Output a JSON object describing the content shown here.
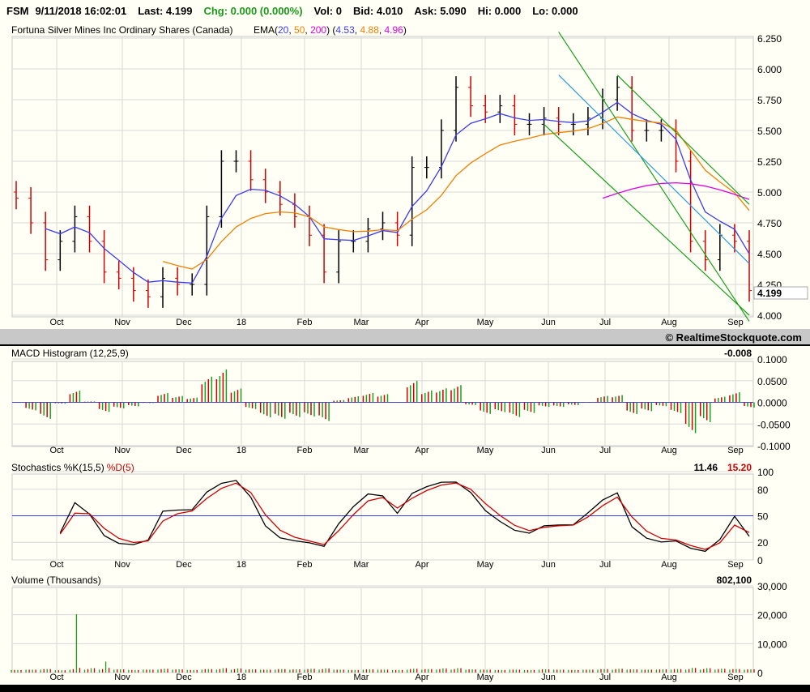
{
  "quote": {
    "symbol": "FSM",
    "datetime": "9/11/2018 16:02:01",
    "last": "Last: 4.199",
    "chg": "Chg: 0.000 (0.000%)",
    "vol": "Vol: 0",
    "bid": "Bid: 4.010",
    "ask": "Ask: 5.090",
    "hi": "Hi: 0.000",
    "lo": "Lo: 0.000"
  },
  "copyright": "© RealtimeStockquote.com",
  "chart_data": [
    {
      "type": "ohlc",
      "title": "Fortuna Silver Mines Inc Ordinary Shares (Canada)",
      "ema_label": "EMA(",
      "ema_periods": [
        "20",
        "50",
        "200"
      ],
      "ema_values": [
        "4.53",
        "4.88",
        "4.96"
      ],
      "ema_colors": [
        "#3b3bf0",
        "#f08000",
        "#e000e0"
      ],
      "last_label": "4.199",
      "x_ticks": [
        "Oct",
        "Nov",
        "Dec",
        "18",
        "Feb",
        "Mar",
        "Apr",
        "May",
        "Jun",
        "Jul",
        "Aug",
        "Sep"
      ],
      "y_ticks": [
        "6.250",
        "6.000",
        "5.750",
        "5.500",
        "5.250",
        "5.000",
        "4.750",
        "4.500",
        "4.250",
        "4.000"
      ],
      "ylim": [
        4.0,
        6.25
      ],
      "weekly_close": [
        4.95,
        4.75,
        4.45,
        4.6,
        4.8,
        4.6,
        4.35,
        4.3,
        4.2,
        4.15,
        4.3,
        4.25,
        4.25,
        4.8,
        5.25,
        5.25,
        5.1,
        5.0,
        4.9,
        4.8,
        4.65,
        4.35,
        4.6,
        4.6,
        4.7,
        4.75,
        4.65,
        5.2,
        5.2,
        5.5,
        5.85,
        5.7,
        5.65,
        5.7,
        5.55,
        5.55,
        5.6,
        5.55,
        5.55,
        5.6,
        5.75,
        5.85,
        5.5,
        5.5,
        5.5,
        5.25,
        4.6,
        4.45,
        4.65,
        4.6,
        4.2
      ],
      "trendlines": [
        {
          "color": "#1aa01a",
          "points": [
            [
              37,
              6.3
            ],
            [
              50,
              3.95
            ]
          ]
        },
        {
          "color": "#1aa01a",
          "points": [
            [
              36,
              5.55
            ],
            [
              50,
              4.0
            ]
          ]
        },
        {
          "color": "#1aa01a",
          "points": [
            [
              41,
              5.95
            ],
            [
              50,
              4.9
            ]
          ]
        },
        {
          "color": "#2a9ae0",
          "points": [
            [
              37,
              5.95
            ],
            [
              50,
              4.42
            ]
          ]
        }
      ]
    },
    {
      "type": "bar",
      "title": "MACD Histogram (12,25,9)",
      "last_value": "-0.008",
      "y_ticks": [
        "0.1000",
        "0.0500",
        "0.0000",
        "-0.0500",
        "-0.1000"
      ],
      "ylim": [
        -0.1,
        0.1
      ]
    },
    {
      "type": "line",
      "title": "Stochastics %K(15,5)",
      "d_label": "%D(5)",
      "k_value": "11.46",
      "d_value": "15.20",
      "y_ticks": [
        "100",
        "80",
        "50",
        "20",
        "0"
      ],
      "ylim": [
        0,
        100
      ]
    },
    {
      "type": "bar",
      "title": "Volume (Thousands)",
      "last_value": "802,100",
      "y_ticks": [
        "30,000",
        "20,000",
        "10,000",
        "0"
      ],
      "ylim": [
        0,
        30000
      ],
      "weekly_volume": [
        900,
        1000,
        1200,
        800,
        20200,
        1500,
        3800,
        1100,
        900,
        1000,
        1300,
        1100,
        900,
        1200,
        1500,
        1400,
        1100,
        1000,
        1200,
        1100,
        1300,
        1400,
        1000,
        900,
        1100,
        1000,
        900,
        1300,
        1200,
        1400,
        1500,
        1100,
        1000,
        900,
        1000,
        900,
        1100,
        1000,
        900,
        1000,
        1200,
        1300,
        1100,
        1000,
        1100,
        1200,
        1600,
        1500,
        1300,
        1200,
        1100
      ]
    }
  ]
}
